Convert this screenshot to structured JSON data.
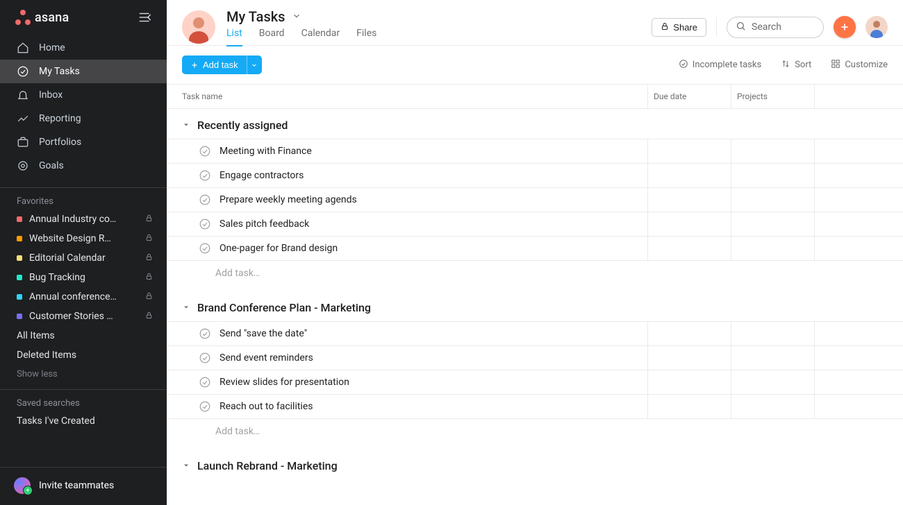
{
  "brand": "asana",
  "nav": [
    {
      "icon": "home",
      "label": "Home"
    },
    {
      "icon": "check",
      "label": "My Tasks"
    },
    {
      "icon": "bell",
      "label": "Inbox"
    },
    {
      "icon": "chart",
      "label": "Reporting"
    },
    {
      "icon": "briefcase",
      "label": "Portfolios"
    },
    {
      "icon": "target",
      "label": "Goals"
    }
  ],
  "favorites_header": "Favorites",
  "favorites": [
    {
      "color": "#f06a6a",
      "label": "Annual Industry co…"
    },
    {
      "color": "#fd9a00",
      "label": "Website Design R…"
    },
    {
      "color": "#f8df72",
      "label": "Editorial Calendar"
    },
    {
      "color": "#25e8c8",
      "label": "Bug Tracking"
    },
    {
      "color": "#2ed6f5",
      "label": "Annual conference…"
    },
    {
      "color": "#7a6ff0",
      "label": "Customer Stories …"
    }
  ],
  "all_items": "All Items",
  "deleted_items": "Deleted Items",
  "show_less": "Show less",
  "saved_searches_header": "Saved searches",
  "tasks_created": "Tasks I've Created",
  "invite": "Invite teammates",
  "page_title": "My Tasks",
  "tabs": [
    "List",
    "Board",
    "Calendar",
    "Files"
  ],
  "share": "Share",
  "search_placeholder": "Search",
  "add_task": "Add task",
  "toolbar": {
    "incomplete": "Incomplete tasks",
    "sort": "Sort",
    "customize": "Customize"
  },
  "columns": {
    "name": "Task name",
    "due": "Due date",
    "projects": "Projects"
  },
  "sections": [
    {
      "title": "Recently assigned",
      "tasks": [
        "Meeting with Finance",
        "Engage contractors",
        "Prepare weekly meeting agends",
        "Sales pitch feedback",
        "One-pager for Brand design"
      ]
    },
    {
      "title": "Brand Conference Plan - Marketing",
      "tasks": [
        "Send \"save the date\"",
        "Send event reminders",
        "Review slides for presentation",
        "Reach out to facilities"
      ]
    },
    {
      "title": "Launch Rebrand - Marketing",
      "tasks": []
    }
  ],
  "add_task_placeholder": "Add task…"
}
